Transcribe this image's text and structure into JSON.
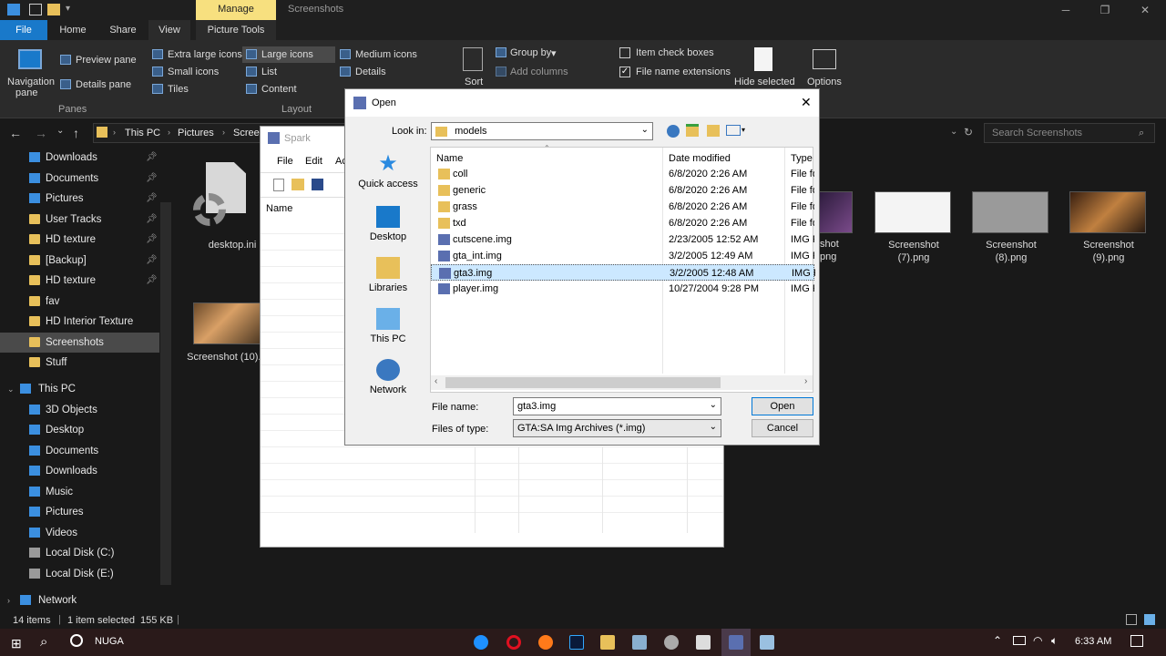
{
  "explorer": {
    "manage_tab": "Manage",
    "window_title": "Screenshots",
    "tabs": [
      "File",
      "Home",
      "Share",
      "View",
      "Picture Tools"
    ],
    "ribbon": {
      "navigation_pane": "Navigation",
      "navigation_pane2": "pane",
      "preview_pane": "Preview pane",
      "details_pane": "Details pane",
      "panes_label": "Panes",
      "extra_large_icons": "Extra large icons",
      "large_icons": "Large icons",
      "medium_icons": "Medium icons",
      "small_icons": "Small icons",
      "list": "List",
      "details": "Details",
      "tiles": "Tiles",
      "content": "Content",
      "layout_label": "Layout",
      "sort": "Sort",
      "group_by": "Group by",
      "add_columns": "Add columns",
      "item_check_boxes": "Item check boxes",
      "file_name_extensions": "File name extensions",
      "hide_selected": "Hide selected",
      "options": "Options"
    },
    "breadcrumb": [
      "This PC",
      "Pictures",
      "Scree"
    ],
    "search_placeholder": "Search Screenshots",
    "nav_quick": [
      {
        "label": "Downloads",
        "pinned": true
      },
      {
        "label": "Documents",
        "pinned": true
      },
      {
        "label": "Pictures",
        "pinned": true
      },
      {
        "label": "User Tracks",
        "pinned": true
      },
      {
        "label": "HD texture",
        "pinned": true
      },
      {
        "label": "[Backup]",
        "pinned": true
      },
      {
        "label": "HD texture",
        "pinned": true
      },
      {
        "label": "fav",
        "pinned": false
      },
      {
        "label": "HD Interior Texture",
        "pinned": false
      },
      {
        "label": "Screenshots",
        "pinned": false
      },
      {
        "label": "Stuff",
        "pinned": false
      }
    ],
    "this_pc": "This PC",
    "nav_pc": [
      "3D Objects",
      "Desktop",
      "Documents",
      "Downloads",
      "Music",
      "Pictures",
      "Videos",
      "Local Disk (C:)",
      "Local Disk (E:)"
    ],
    "network": "Network",
    "files": [
      {
        "name": "desktop.ini"
      },
      {
        "name": "Screenshot (10).png"
      }
    ],
    "thumbs": [
      {
        "line1": "shot",
        "line2": "png"
      },
      {
        "line1": "Screenshot",
        "line2": "(7).png"
      },
      {
        "line1": "Screenshot",
        "line2": "(8).png"
      },
      {
        "line1": "Screenshot",
        "line2": "(9).png"
      }
    ],
    "status": {
      "items": "14 items",
      "selected": "1 item selected",
      "size": "155 KB"
    }
  },
  "spark": {
    "title": "Spark",
    "menu": [
      "File",
      "Edit",
      "Ac"
    ],
    "column_name": "Name"
  },
  "open_dialog": {
    "title": "Open",
    "look_in_label": "Look in:",
    "look_in_value": "models",
    "places": [
      "Quick access",
      "Desktop",
      "Libraries",
      "This PC",
      "Network"
    ],
    "columns": {
      "name": "Name",
      "date": "Date modified",
      "type": "Type"
    },
    "rows": [
      {
        "name": "coll",
        "date": "6/8/2020 2:26 AM",
        "type": "File fo",
        "kind": "folder"
      },
      {
        "name": "generic",
        "date": "6/8/2020 2:26 AM",
        "type": "File fo",
        "kind": "folder"
      },
      {
        "name": "grass",
        "date": "6/8/2020 2:26 AM",
        "type": "File fo",
        "kind": "folder"
      },
      {
        "name": "txd",
        "date": "6/8/2020 2:26 AM",
        "type": "File fo",
        "kind": "folder"
      },
      {
        "name": "cutscene.img",
        "date": "2/23/2005 12:52 AM",
        "type": "IMG F",
        "kind": "img"
      },
      {
        "name": "gta_int.img",
        "date": "3/2/2005 12:49 AM",
        "type": "IMG F",
        "kind": "img"
      },
      {
        "name": "gta3.img",
        "date": "3/2/2005 12:48 AM",
        "type": "IMG F",
        "kind": "img",
        "selected": true
      },
      {
        "name": "player.img",
        "date": "10/27/2004 9:28 PM",
        "type": "IMG F",
        "kind": "img"
      }
    ],
    "file_name_label": "File name:",
    "file_name_value": "gta3.img",
    "files_of_type_label": "Files of type:",
    "files_of_type_value": "GTA:SA Img Archives (*.img)",
    "open_button": "Open",
    "cancel_button": "Cancel"
  },
  "taskbar": {
    "search_text": "NUGA",
    "time": "6:33 AM"
  }
}
